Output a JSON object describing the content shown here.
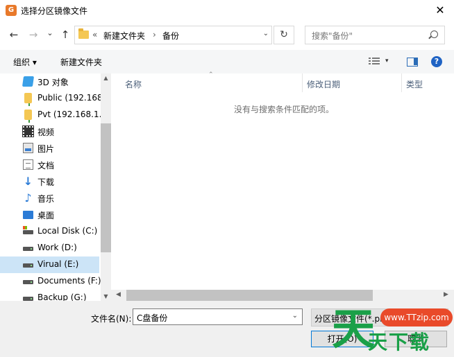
{
  "window": {
    "title": "选择分区镜像文件",
    "close_glyph": "✕"
  },
  "nav": {
    "back_glyph": "←",
    "forward_glyph": "→",
    "recent_glyph": "⌄",
    "up_glyph": "↑",
    "breadcrumb_sep": "«",
    "breadcrumbs": [
      "新建文件夹",
      "备份"
    ],
    "crumb_arrow": "›",
    "address_dropdown_glyph": "⌄",
    "refresh_glyph": "↻",
    "search_placeholder": "搜索\"备份\""
  },
  "toolbar": {
    "organize": "组织 ▾",
    "new_folder": "新建文件夹",
    "view_dropdown_glyph": "▾",
    "help_glyph": "?"
  },
  "tree": {
    "items": [
      {
        "label": "3D 对象",
        "icon": "3d-objects-icon"
      },
      {
        "label": "Public (192.168.",
        "icon": "network-folder-icon"
      },
      {
        "label": "Pvt (192.168.1.1",
        "icon": "network-folder-icon"
      },
      {
        "label": "视频",
        "icon": "video-icon"
      },
      {
        "label": "图片",
        "icon": "pictures-icon"
      },
      {
        "label": "文档",
        "icon": "documents-icon"
      },
      {
        "label": "下载",
        "icon": "downloads-icon"
      },
      {
        "label": "音乐",
        "icon": "music-icon"
      },
      {
        "label": "桌面",
        "icon": "desktop-icon"
      },
      {
        "label": "Local Disk (C:)",
        "icon": "system-drive-icon"
      },
      {
        "label": "Work (D:)",
        "icon": "drive-icon"
      },
      {
        "label": "Virual (E:)",
        "icon": "drive-icon"
      },
      {
        "label": "Documents (F:)",
        "icon": "drive-icon"
      },
      {
        "label": "Backup (G:)",
        "icon": "drive-icon"
      }
    ],
    "selected_label": "Virual (E:)",
    "scroll_up_glyph": "▲",
    "scroll_down_glyph": "▼"
  },
  "content": {
    "columns": [
      "名称",
      "修改日期",
      "类型"
    ],
    "sort_glyph": "⌃",
    "empty_message": "没有与搜索条件匹配的项。",
    "scroll_left_glyph": "◀",
    "scroll_right_glyph": "▶"
  },
  "footer": {
    "filename_label": "文件名(N):",
    "filename_value": "C盘备份",
    "filename_dropdown_glyph": "⌄",
    "filetype_value": "分区镜像文件(*.pm",
    "open_button": "打开(O)",
    "cancel_button": "取消"
  },
  "watermark": {
    "mark": "天",
    "site": "www.TTzip.com",
    "name": "天下载"
  },
  "colors": {
    "selection": "#cce4f7",
    "accent": "#0078d7",
    "watermark_green": "#1aa048",
    "watermark_red": "#e94a2a"
  }
}
